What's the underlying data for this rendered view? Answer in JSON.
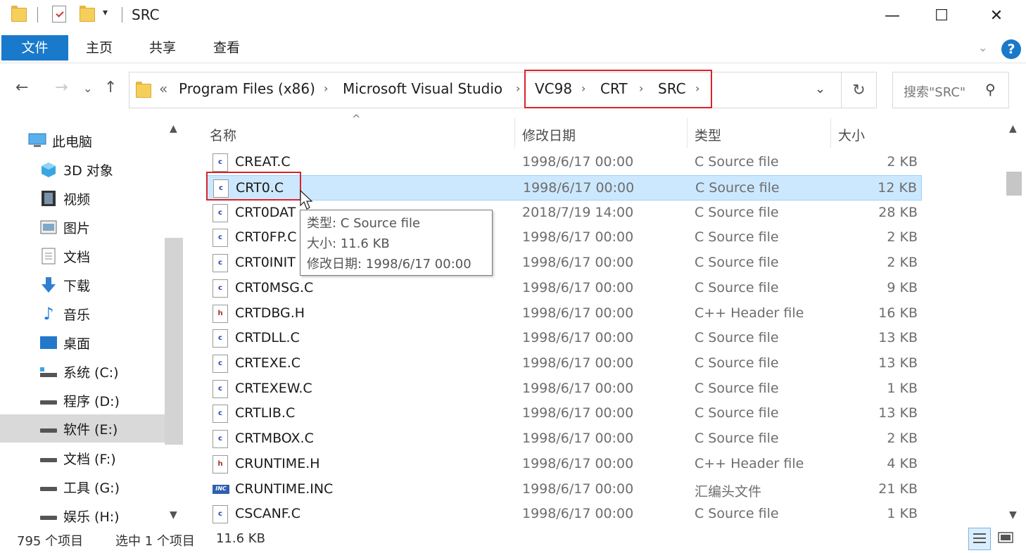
{
  "window": {
    "title": "SRC",
    "minimize_glyph": "—",
    "maximize_glyph": "☐",
    "close_glyph": "✕"
  },
  "quick_access": {
    "dropdown_glyph": "▾"
  },
  "ribbon": {
    "tabs": [
      "文件",
      "主页",
      "共享",
      "查看"
    ],
    "help_label": "?",
    "collapse_glyph": "⌄"
  },
  "nav": {
    "back_glyph": "←",
    "forward_glyph": "→",
    "recent_glyph": "⌄",
    "up_glyph": "↑",
    "overflow": "«",
    "breadcrumbs": [
      "Program Files (x86)",
      "Microsoft Visual Studio",
      "VC98",
      "CRT",
      "SRC"
    ],
    "separator": "›",
    "dropdown_glyph": "⌄",
    "refresh_glyph": "↻",
    "search_placeholder": "搜索\"SRC\"",
    "search_glyph": "⚲"
  },
  "sidebar": {
    "items": [
      {
        "label": "此电脑",
        "icon": "computer-icon"
      },
      {
        "label": "3D 对象",
        "icon": "3d-objects-icon"
      },
      {
        "label": "视频",
        "icon": "video-icon"
      },
      {
        "label": "图片",
        "icon": "pictures-icon"
      },
      {
        "label": "文档",
        "icon": "documents-icon"
      },
      {
        "label": "下载",
        "icon": "downloads-icon"
      },
      {
        "label": "音乐",
        "icon": "music-icon"
      },
      {
        "label": "桌面",
        "icon": "desktop-icon"
      },
      {
        "label": "系统 (C:)",
        "icon": "system-drive-icon"
      },
      {
        "label": "程序 (D:)",
        "icon": "drive-icon"
      },
      {
        "label": "软件 (E:)",
        "icon": "drive-icon",
        "selected": true
      },
      {
        "label": "文档 (F:)",
        "icon": "drive-icon"
      },
      {
        "label": "工具 (G:)",
        "icon": "drive-icon"
      },
      {
        "label": "娱乐 (H:)",
        "icon": "drive-icon"
      }
    ]
  },
  "columns": {
    "name": "名称",
    "date": "修改日期",
    "type": "类型",
    "size": "大小",
    "sort_glyph": "^"
  },
  "files": [
    {
      "name": "CREAT.C",
      "date": "1998/6/17 00:00",
      "type": "C Source file",
      "size": "2 KB",
      "kind": "c"
    },
    {
      "name": "CRT0.C",
      "date": "1998/6/17 00:00",
      "type": "C Source file",
      "size": "12 KB",
      "kind": "c",
      "selected": true
    },
    {
      "name": "CRT0DAT",
      "date": "2018/7/19 14:00",
      "type": "C Source file",
      "size": "28 KB",
      "kind": "c"
    },
    {
      "name": "CRT0FP.C",
      "date": "1998/6/17 00:00",
      "type": "C Source file",
      "size": "2 KB",
      "kind": "c"
    },
    {
      "name": "CRT0INIT",
      "date": "1998/6/17 00:00",
      "type": "C Source file",
      "size": "2 KB",
      "kind": "c"
    },
    {
      "name": "CRT0MSG.C",
      "date": "1998/6/17 00:00",
      "type": "C Source file",
      "size": "9 KB",
      "kind": "c"
    },
    {
      "name": "CRTDBG.H",
      "date": "1998/6/17 00:00",
      "type": "C++ Header file",
      "size": "16 KB",
      "kind": "h"
    },
    {
      "name": "CRTDLL.C",
      "date": "1998/6/17 00:00",
      "type": "C Source file",
      "size": "13 KB",
      "kind": "c"
    },
    {
      "name": "CRTEXE.C",
      "date": "1998/6/17 00:00",
      "type": "C Source file",
      "size": "13 KB",
      "kind": "c"
    },
    {
      "name": "CRTEXEW.C",
      "date": "1998/6/17 00:00",
      "type": "C Source file",
      "size": "1 KB",
      "kind": "c"
    },
    {
      "name": "CRTLIB.C",
      "date": "1998/6/17 00:00",
      "type": "C Source file",
      "size": "13 KB",
      "kind": "c"
    },
    {
      "name": "CRTMBOX.C",
      "date": "1998/6/17 00:00",
      "type": "C Source file",
      "size": "2 KB",
      "kind": "c"
    },
    {
      "name": "CRUNTIME.H",
      "date": "1998/6/17 00:00",
      "type": "C++ Header file",
      "size": "4 KB",
      "kind": "h"
    },
    {
      "name": "CRUNTIME.INC",
      "date": "1998/6/17 00:00",
      "type": "汇编头文件",
      "size": "21 KB",
      "kind": "inc"
    },
    {
      "name": "CSCANF.C",
      "date": "1998/6/17 00:00",
      "type": "C Source file",
      "size": "1 KB",
      "kind": "c"
    }
  ],
  "tooltip": {
    "type_line": "类型: C Source file",
    "size_line": "大小: 11.6 KB",
    "date_line": "修改日期: 1998/6/17 00:00"
  },
  "status": {
    "item_count": "795 个项目",
    "selection": "选中 1 个项目",
    "selection_size": "11.6 KB"
  },
  "colors": {
    "accent": "#1979ca",
    "selection_bg": "#cce8ff",
    "highlight_box": "#d8232a"
  }
}
